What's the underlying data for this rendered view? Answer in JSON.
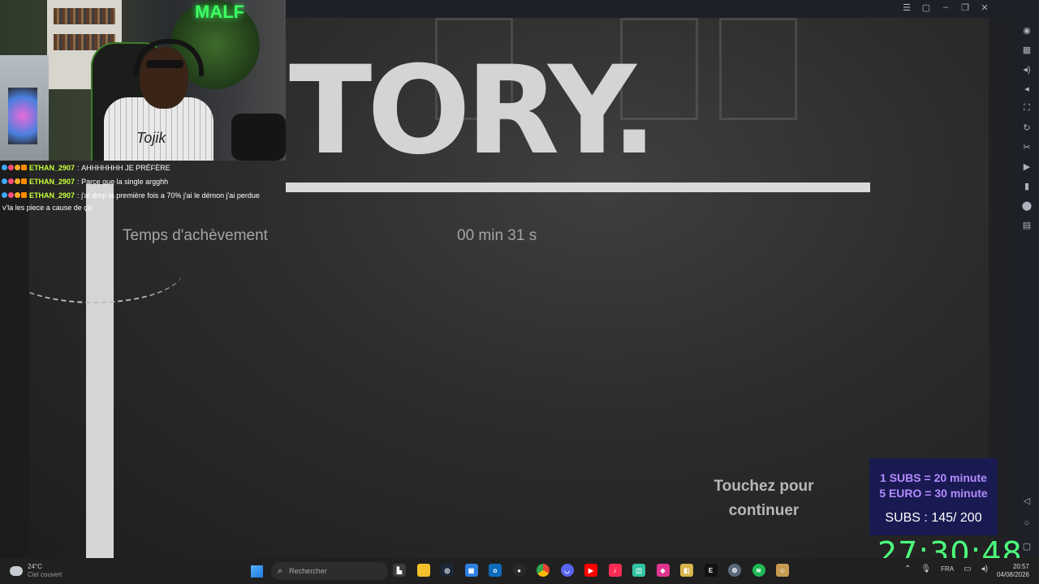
{
  "game": {
    "title_fragment": "TORY.",
    "stat_label": "Temps d'achèvement",
    "stat_value": "00 min 31 s",
    "continue_line1": "Touchez pour",
    "continue_line2": "continuer"
  },
  "webcam": {
    "neon_sign": "MALF",
    "shirt_text": "Tojik"
  },
  "chat": {
    "messages": [
      {
        "user": "ETHAN_2907",
        "sep": ":",
        "text": "AHHHHHHH JE PRÉFÈRE"
      },
      {
        "user": "ETHAN_2907",
        "sep": ":",
        "text": "Parce que la single argghh"
      },
      {
        "user": "ETHAN_2907",
        "sep": ":",
        "text": "j'ai drop la première fois a 70% j'ai le démon j'ai perdue",
        "continuation": "v'la les piece a cause de ça"
      }
    ],
    "username_color": "#c8ff3a"
  },
  "subathon": {
    "line1": "1 SUBS = 20 minute",
    "line2": "5 EURO = 30 minute",
    "subs": "SUBS : 145/ 200",
    "timer": "27:30:48"
  },
  "taskbar": {
    "weather_temp": "24°C",
    "weather_desc": "Ciel couvert",
    "search_placeholder": "Rechercher",
    "language": "FRA",
    "time": "20:57",
    "date": "04/08/2026",
    "apps": [
      "file-manager",
      "folder",
      "steam",
      "store",
      "outlook",
      "obs",
      "chrome",
      "discord",
      "youtube",
      "tiktok",
      "streamlabs",
      "app-pink",
      "app-yellow",
      "epic-games",
      "settings",
      "spotify",
      "app-avatar"
    ]
  },
  "colors": {
    "accent_green": "#4cff7c",
    "sub_box_bg": "#1a1a52",
    "sub_text_purple": "#b28cff"
  }
}
